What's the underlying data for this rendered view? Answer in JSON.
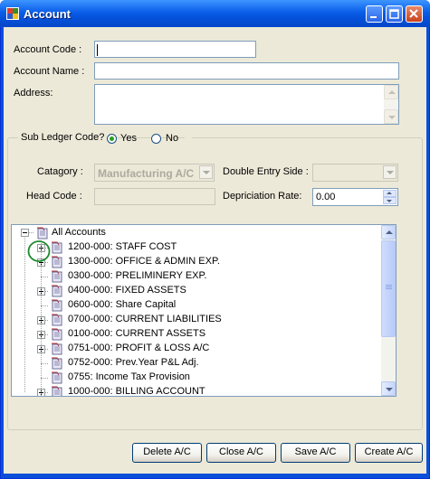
{
  "window": {
    "title": "Account"
  },
  "form": {
    "account_code_label": "Account Code :",
    "account_code_value": "",
    "account_name_label": "Account Name :",
    "account_name_value": "",
    "address_label": "Address:",
    "address_value": ""
  },
  "subledger": {
    "legend": "Sub Ledger Code?",
    "yes_label": "Yes",
    "no_label": "No",
    "selected": "Yes",
    "category_label": "Catagory :",
    "category_value": "Manufacturing A/C",
    "head_code_label": "Head Code :",
    "head_code_value": "",
    "double_entry_label": "Double Entry Side :",
    "double_entry_value": "",
    "depreciation_label": "Depriciation Rate:",
    "depreciation_value": "0.00"
  },
  "tree": {
    "root": {
      "label": "All Accounts",
      "expanded": true
    },
    "items": [
      {
        "label": "1200-000:  STAFF COST",
        "expandable": true
      },
      {
        "label": "1300-000:  OFFICE & ADMIN EXP.",
        "expandable": true
      },
      {
        "label": "0300-000:  PRELIMINERY EXP.",
        "expandable": false
      },
      {
        "label": "0400-000:  FIXED ASSETS",
        "expandable": true
      },
      {
        "label": "0600-000:  Share Capital",
        "expandable": false
      },
      {
        "label": "0700-000:  CURRENT LIABILITIES",
        "expandable": true
      },
      {
        "label": "0100-000:  CURRENT ASSETS",
        "expandable": true
      },
      {
        "label": "0751-000:  PROFIT & LOSS A/C",
        "expandable": true
      },
      {
        "label": "0752-000:  Prev.Year P&L Adj.",
        "expandable": false
      },
      {
        "label": "0755:  Income Tax Provision",
        "expandable": false
      },
      {
        "label": "1000-000:  BILLING ACCOUNT",
        "expandable": true
      }
    ]
  },
  "buttons": {
    "delete": "Delete A/C",
    "close": "Close A/C",
    "save": "Save A/C",
    "create": "Create A/C"
  },
  "colors": {
    "titlebar": "#0a5ee8",
    "face": "#ece9d8",
    "highlight_circle": "#1a8a2a"
  }
}
